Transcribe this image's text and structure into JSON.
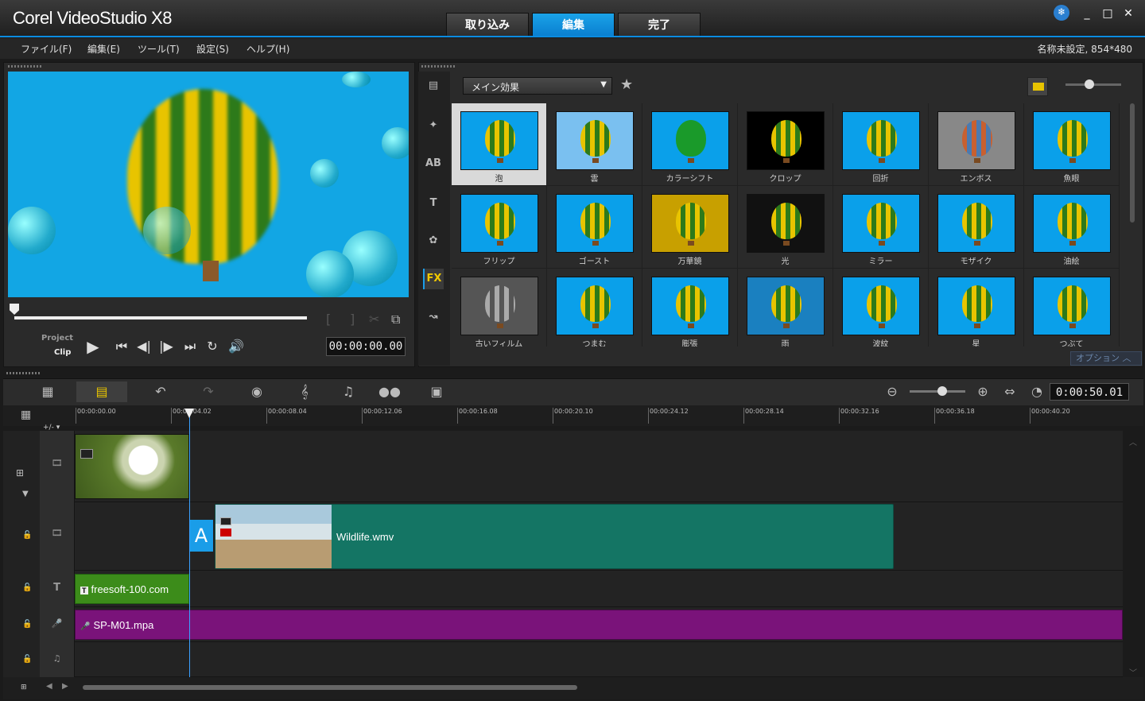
{
  "window": {
    "title": "Corel VideoStudio X8",
    "project_info": "名称未設定, 854*480"
  },
  "tabs": [
    {
      "label": "取り込み"
    },
    {
      "label": "編集",
      "active": true
    },
    {
      "label": "完了"
    }
  ],
  "menu": [
    "ファイル(F)",
    "編集(E)",
    "ツール(T)",
    "設定(S)",
    "ヘルプ(H)"
  ],
  "player": {
    "mode_project": "Project",
    "mode_clip": "Clip",
    "timecode": "00:00:00.00",
    "bracket_in": "[",
    "bracket_out": "]"
  },
  "library": {
    "category_dropdown": "メイン効果",
    "options_label": "オプション",
    "thumbs": [
      {
        "label": "泡",
        "selected": true
      },
      {
        "label": "雲"
      },
      {
        "label": "カラーシフト"
      },
      {
        "label": "クロップ"
      },
      {
        "label": "回折"
      },
      {
        "label": "エンボス"
      },
      {
        "label": "魚眼"
      },
      {
        "label": "フリップ"
      },
      {
        "label": "ゴースト"
      },
      {
        "label": "万華鏡"
      },
      {
        "label": "光"
      },
      {
        "label": "ミラー"
      },
      {
        "label": "モザイク"
      },
      {
        "label": "油絵"
      },
      {
        "label": "古いフィルム"
      },
      {
        "label": "つまむ"
      },
      {
        "label": "膨張"
      },
      {
        "label": "雨"
      },
      {
        "label": "波紋"
      },
      {
        "label": "星"
      },
      {
        "label": "つぶて"
      }
    ]
  },
  "side_icons": [
    {
      "name": "media-icon",
      "glyph": "▤"
    },
    {
      "name": "instant-project-icon",
      "glyph": "✦"
    },
    {
      "name": "transition-icon",
      "glyph": "AB"
    },
    {
      "name": "title-icon",
      "glyph": "T"
    },
    {
      "name": "graphic-icon",
      "glyph": "✿"
    },
    {
      "name": "filter-icon",
      "glyph": "FX"
    },
    {
      "name": "path-icon",
      "glyph": "↝"
    }
  ],
  "timeline": {
    "duration": "0:00:50.01",
    "add_remove": "+/-",
    "ruler": [
      "00:00:00.00",
      "00:00:04.02",
      "00:00:08.04",
      "00:00:12.06",
      "00:00:16.08",
      "00:00:20.10",
      "00:00:24.12",
      "00:00:28.14",
      "00:00:32.16",
      "00:00:36.18",
      "00:00:40.20"
    ],
    "clips": {
      "video2": "Wildlife.wmv",
      "title": "freesoft-100.com",
      "voice": "SP-M01.mpa"
    }
  }
}
